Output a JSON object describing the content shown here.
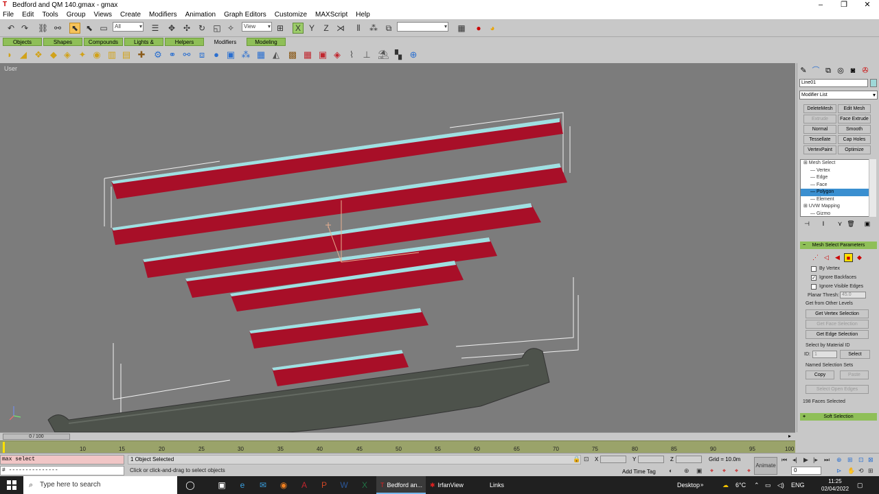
{
  "window": {
    "title": "Bedford and QM 140.gmax - gmax",
    "minimize": "–",
    "restore": "❐",
    "close": "✕"
  },
  "menu": [
    "File",
    "Edit",
    "Tools",
    "Group",
    "Views",
    "Create",
    "Modifiers",
    "Animation",
    "Graph Editors",
    "Customize",
    "MAXScript",
    "Help"
  ],
  "toolbar": {
    "filter_value": "All",
    "refcoord_value": "View"
  },
  "tabs": [
    "Objects",
    "Shapes",
    "Compounds",
    "Lights & Cameras",
    "Helpers",
    "Modifiers",
    "Modeling"
  ],
  "viewport": {
    "label": "User",
    "axis_label": "y x z"
  },
  "panel": {
    "object_name": "Line01",
    "modifier_list": "Modifier List",
    "buttons": [
      [
        "DeleteMesh",
        "Edit Mesh"
      ],
      [
        "Extrude",
        "Face Extrude"
      ],
      [
        "Normal",
        "Smooth"
      ],
      [
        "Tessellate",
        "Cap Holes"
      ],
      [
        "VertexPaint",
        "Optimize"
      ]
    ],
    "stack": [
      {
        "label": "⊞ Mesh Select",
        "box": true
      },
      {
        "label": "— Vertex",
        "box": false
      },
      {
        "label": "— Edge",
        "box": false
      },
      {
        "label": "— Face",
        "box": false
      },
      {
        "label": "— Polygon",
        "box": true
      },
      {
        "label": "— Element",
        "box": false
      },
      {
        "label": "⊞ UVW Mapping",
        "box": true
      },
      {
        "label": "— Gizmo",
        "box": true
      }
    ],
    "rollout_title": "Mesh Select Parameters",
    "by_vertex": "By Vertex",
    "ignore_backfaces": "Ignore Backfaces",
    "ignore_visible_edges": "Ignore Visible Edges",
    "planar_thresh_label": "Planar Thresh:",
    "planar_thresh_value": "45.0",
    "get_from_other": "Get from Other Levels",
    "get_vertex": "Get Vertex Selection",
    "get_face": "Get Face Selection",
    "get_edge": "Get Edge Selection",
    "select_by_material": "Select by Material ID",
    "id_label": "ID:",
    "id_value": "1",
    "select_btn": "Select",
    "named_sets": "Named Selection Sets",
    "copy": "Copy",
    "paste": "Paste",
    "select_open_edges": "Select Open Edges",
    "faces_selected": "198 Faces Selected",
    "soft_selection": "Soft Selection"
  },
  "timeline": {
    "slider": "0 / 100",
    "ticks": [
      "10",
      "15",
      "20",
      "25",
      "30",
      "35",
      "40",
      "45",
      "50",
      "55",
      "60",
      "65",
      "70",
      "75",
      "80",
      "85",
      "90",
      "95",
      "100"
    ]
  },
  "status": {
    "maxscript_cmd": "max select",
    "maxscript_out": "# ---------------",
    "selected": "1 Object Selected",
    "prompt": "Click or click-and-drag to select objects",
    "x_label": "X",
    "y_label": "Y",
    "z_label": "Z",
    "grid": "Grid = 10.0m",
    "add_time_tag": "Add Time Tag",
    "animate": "Animate",
    "frame": "0"
  },
  "taskbar": {
    "search_placeholder": "Type here to search",
    "app1": "Bedford an...",
    "app2": "IrfanView",
    "links": "Links",
    "desktop": "Desktop",
    "temp": "6°C",
    "lang": "ENG",
    "time": "11:25",
    "date": "02/04/2022"
  },
  "colors": {
    "red": "#a80f28",
    "cyan": "#9fe0e2",
    "green_tab": "#8fbf58",
    "viewport": "#7c7c7c",
    "ground": "#4e534c"
  }
}
